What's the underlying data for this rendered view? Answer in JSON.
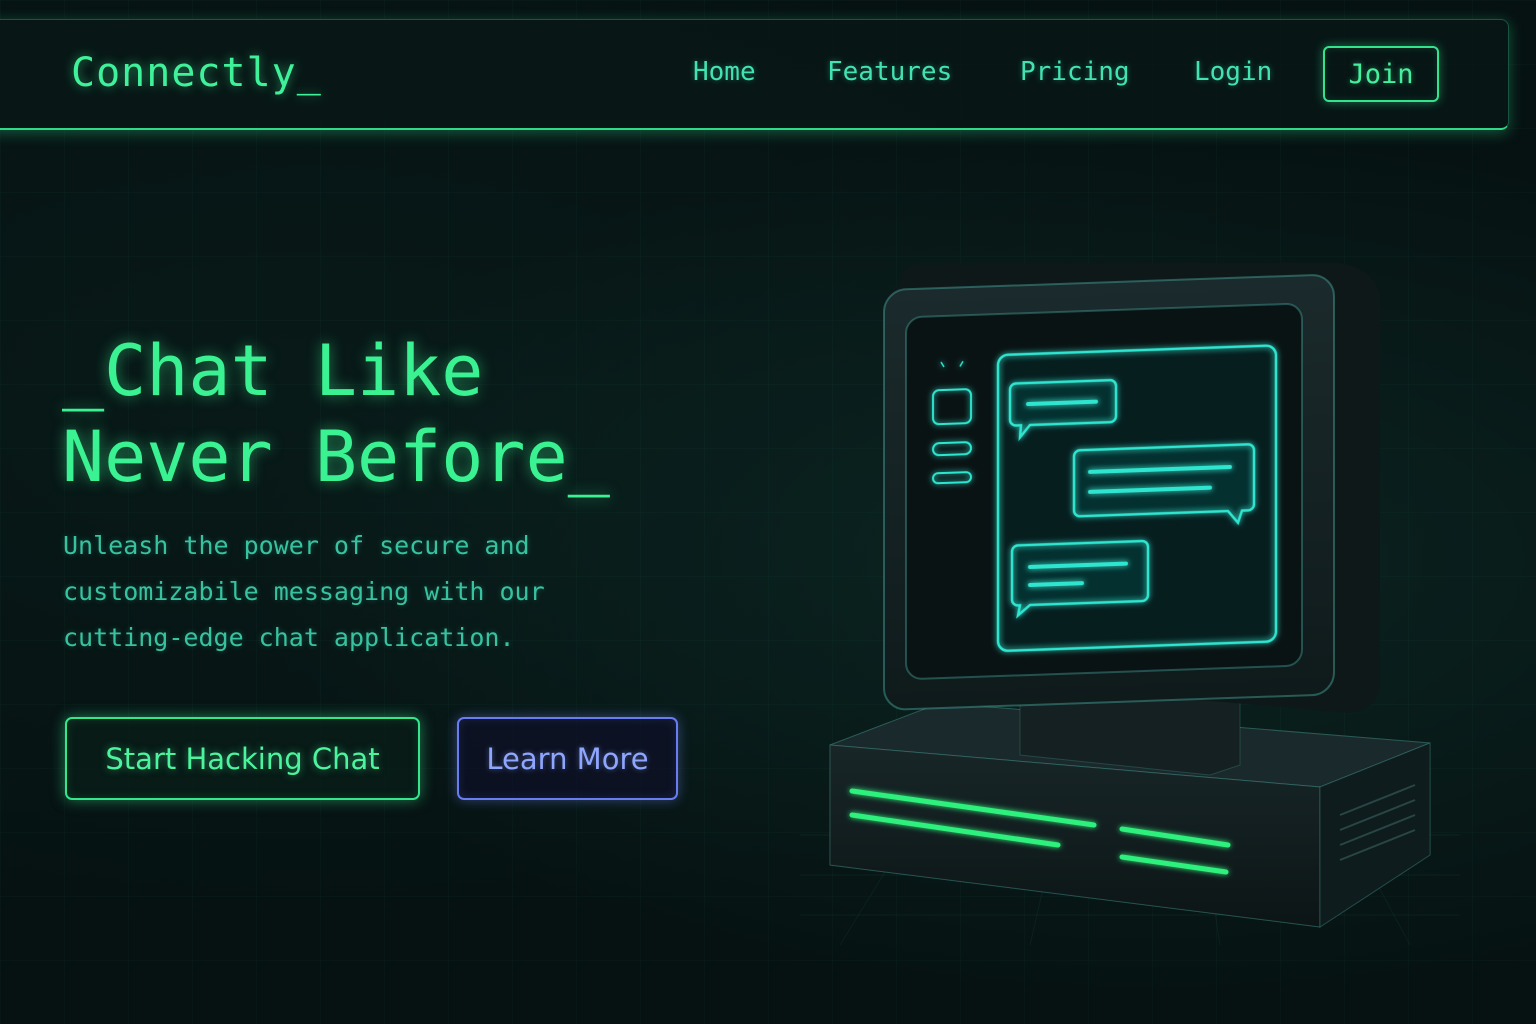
{
  "nav": {
    "logo": "Connectly_",
    "links": [
      "Home",
      "Features",
      "Pricing",
      "Login"
    ],
    "join_label": "Join"
  },
  "hero": {
    "title_lines": [
      "_Chat Like",
      "Never Before_"
    ],
    "description_lines": [
      "Unleash the power of secure and",
      "customizabile messaging with our",
      "cutting-edge chat application."
    ],
    "primary_cta": "Start Hacking Chat",
    "secondary_cta": "Learn More"
  },
  "illustration": {
    "icon": "retro-computer-chat-icon",
    "chat_bubbles": 3
  },
  "colors": {
    "background": "#061212",
    "accent_green": "#3af291",
    "teal_text": "#37c2a0",
    "nav_link": "#42e3b0",
    "secondary_border": "#6a7df0",
    "screen_cyan": "#2ee6d0"
  }
}
